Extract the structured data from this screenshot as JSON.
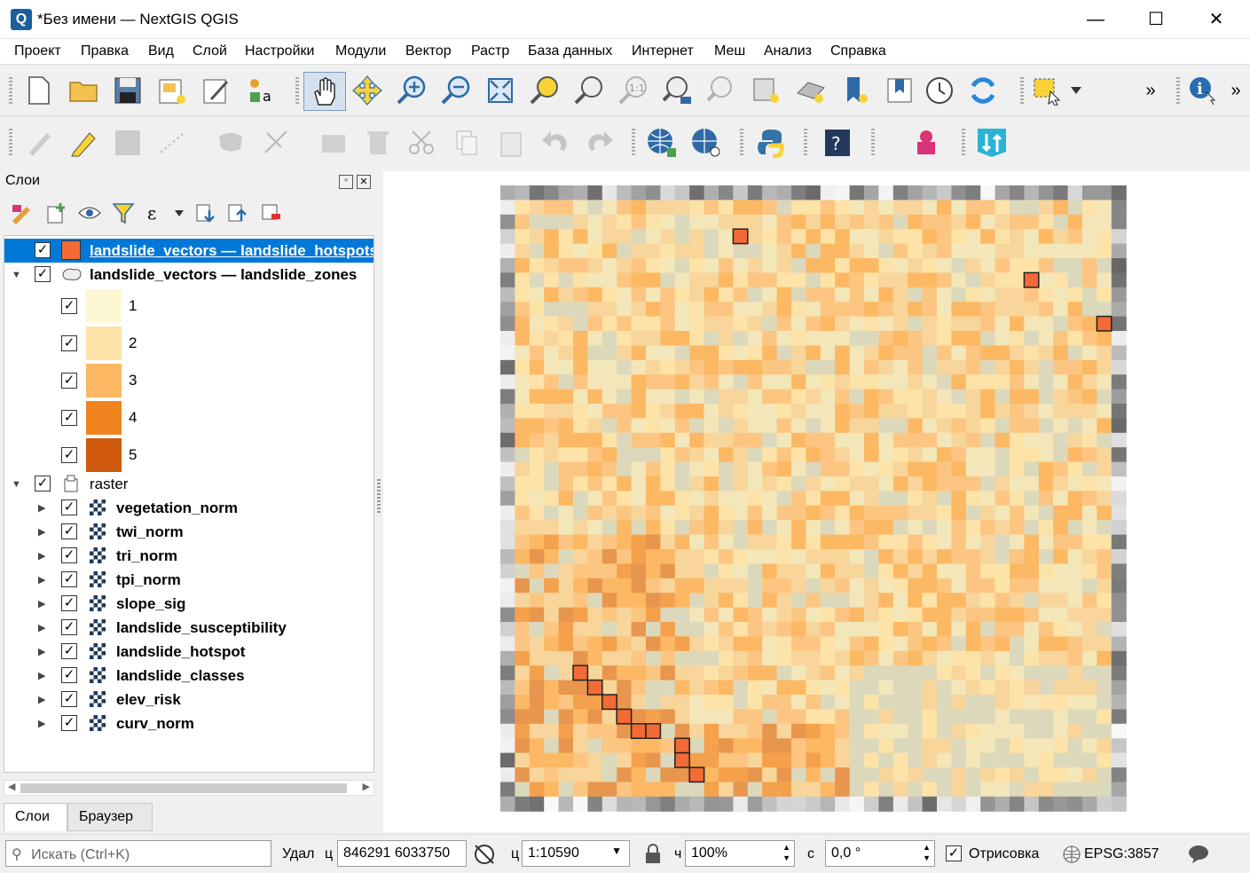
{
  "window": {
    "title": "*Без имени — NextGIS QGIS",
    "app_icon_letter": "Q",
    "minimize": "—",
    "maximize": "☐",
    "close": "✕"
  },
  "menu": [
    "Проект",
    "Правка",
    "Вид",
    "Слой",
    "Настройки",
    "Модули",
    "Вектор",
    "Растр",
    "База данных",
    "Интернет",
    "Меш",
    "Анализ",
    "Справка"
  ],
  "toolbar_overflow": "»",
  "layers_panel": {
    "title": "Слои",
    "items": [
      {
        "label": "landslide_vectors — landslide_hotspots",
        "checked": "✓",
        "color": "#f26a36"
      },
      {
        "label": "landslide_vectors — landslide_zones",
        "checked": "✓"
      },
      {
        "label": "1",
        "checked": "✓",
        "color": "#fef7d5"
      },
      {
        "label": "2",
        "checked": "✓",
        "color": "#fde3a7"
      },
      {
        "label": "3",
        "checked": "✓",
        "color": "#fdb863"
      },
      {
        "label": "4",
        "checked": "✓",
        "color": "#f0831e"
      },
      {
        "label": "5",
        "checked": "✓",
        "color": "#cf5a0e"
      },
      {
        "label": "raster",
        "checked": "✓"
      },
      {
        "label": "vegetation_norm",
        "checked": "✓"
      },
      {
        "label": "twi_norm",
        "checked": "✓"
      },
      {
        "label": "tri_norm",
        "checked": "✓"
      },
      {
        "label": "tpi_norm",
        "checked": "✓"
      },
      {
        "label": "slope_sig",
        "checked": "✓"
      },
      {
        "label": "landslide_susceptibility",
        "checked": "✓"
      },
      {
        "label": "landslide_hotspot",
        "checked": "✓"
      },
      {
        "label": "landslide_classes",
        "checked": "✓"
      },
      {
        "label": "elev_risk",
        "checked": "✓"
      },
      {
        "label": "curv_norm",
        "checked": "✓"
      }
    ],
    "tabs": [
      "Слои",
      "Браузер"
    ]
  },
  "status": {
    "search_placeholder": "Искать (Ctrl+K)",
    "coord_label": "Удал",
    "coord_prefix": "ц",
    "coordinates": "846291  6033750",
    "scale_label": "ц",
    "scale": "1:10590",
    "magnifier_label": "ч",
    "magnifier": "100%",
    "rotation_label": "с",
    "rotation": "0,0 °",
    "render_label": "Отрисовка",
    "render_checked": "✓",
    "crs": "EPSG:3857"
  },
  "map": {
    "palette": [
      "#fef7d5",
      "#fde3a7",
      "#fdb863",
      "#f0831e",
      "#cf5a0e"
    ],
    "hotspot_color": "#f26a36"
  }
}
